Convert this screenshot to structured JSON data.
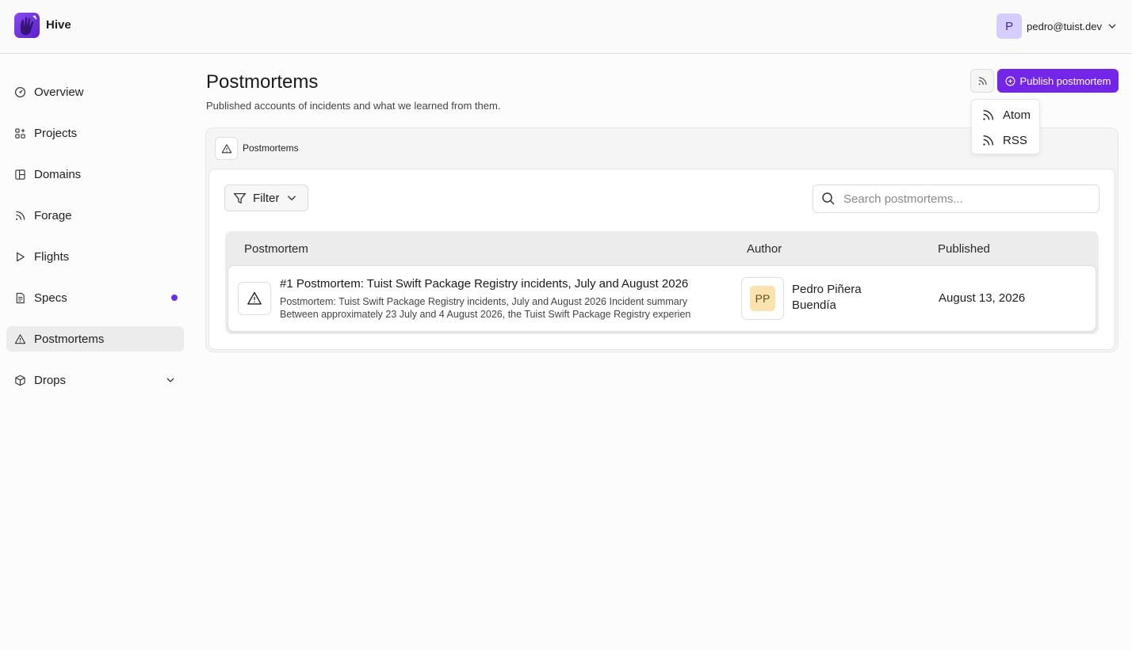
{
  "app": {
    "title": "Hive",
    "user_initial": "P",
    "user_email": "pedro@tuist.dev"
  },
  "sidebar": {
    "items": [
      {
        "label": "Overview",
        "icon": "gauge-icon"
      },
      {
        "label": "Projects",
        "icon": "projects-icon"
      },
      {
        "label": "Domains",
        "icon": "layout-icon"
      },
      {
        "label": "Forage",
        "icon": "rss-icon"
      },
      {
        "label": "Flights",
        "icon": "play-icon"
      },
      {
        "label": "Specs",
        "icon": "file-text-icon",
        "badge_dot": true
      },
      {
        "label": "Postmortems",
        "icon": "alert-triangle-icon",
        "active": true
      },
      {
        "label": "Drops",
        "icon": "box-icon",
        "expandable": true
      }
    ]
  },
  "page": {
    "title": "Postmortems",
    "subtitle": "Published accounts of incidents and what we learned from them.",
    "publish_label": "Publish postmortem",
    "feed_menu": [
      "Atom",
      "RSS"
    ]
  },
  "card": {
    "title": "Postmortems",
    "filter_label": "Filter",
    "search_placeholder": "Search postmortems...",
    "columns": [
      "Postmortem",
      "Author",
      "Published"
    ],
    "rows": [
      {
        "title": "#1 Postmortem: Tuist Swift Package Registry incidents, July and August 2026",
        "excerpt_line1": "Postmortem: Tuist Swift Package Registry incidents, July and August 2026 Incident summary",
        "excerpt_line2": "Between approximately 23 July and 4 August 2026, the Tuist Swift Package Registry experien",
        "author_initials": "PP",
        "author_name": "Pedro Piñera Buendía",
        "published": "August 13, 2026"
      }
    ]
  },
  "colors": {
    "accent": "#7325e8",
    "active_nav": "#ececec",
    "author_avatar_bg": "#fbe3b0",
    "user_avatar_bg": "#d6ccff"
  }
}
